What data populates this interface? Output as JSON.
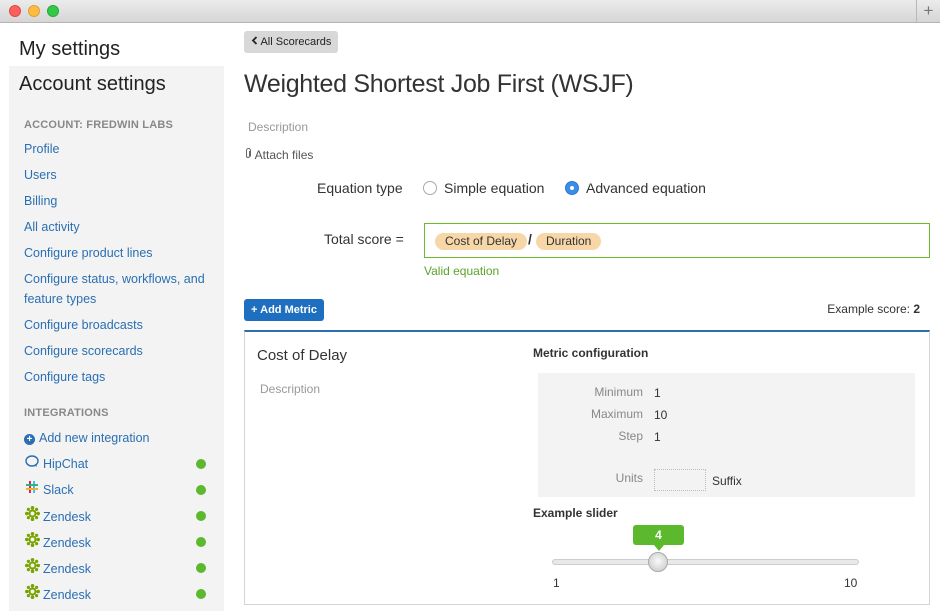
{
  "window": {
    "controls": [
      "close",
      "minimize",
      "zoom"
    ],
    "new_tab_symbol": "+"
  },
  "sidebar": {
    "my_settings": "My settings",
    "account_settings": "Account settings",
    "account_section": "ACCOUNT: FREDWIN LABS",
    "links": {
      "profile": "Profile",
      "users": "Users",
      "billing": "Billing",
      "all_activity": "All activity",
      "product_lines": "Configure product lines",
      "status_line1": "Configure status, workflows, and",
      "status_line2": "feature types",
      "broadcasts": "Configure broadcasts",
      "scorecards": "Configure scorecards",
      "tags": "Configure tags"
    },
    "integrations_section": "INTEGRATIONS",
    "add_integration": "Add new integration",
    "integrations": [
      {
        "label": "HipChat",
        "icon": "hipchat-icon",
        "status": "active"
      },
      {
        "label": "Slack",
        "icon": "slack-icon",
        "status": "active"
      },
      {
        "label": "Zendesk",
        "icon": "zendesk-icon",
        "status": "active"
      },
      {
        "label": "Zendesk",
        "icon": "zendesk-icon",
        "status": "active"
      },
      {
        "label": "Zendesk",
        "icon": "zendesk-icon",
        "status": "active"
      },
      {
        "label": "Zendesk",
        "icon": "zendesk-icon",
        "status": "active"
      }
    ],
    "status_color": "#5cb82c"
  },
  "main": {
    "back_label": "All Scorecards",
    "title": "Weighted Shortest Job First (WSJF)",
    "description_placeholder": "Description",
    "attach_label": "Attach files",
    "equation_type_label": "Equation type",
    "simple_label": "Simple equation",
    "advanced_label": "Advanced equation",
    "selected_equation": "Advanced equation",
    "total_score_label": "Total score =",
    "formula": {
      "term1": "Cost of Delay",
      "operator": "/",
      "term2": "Duration"
    },
    "valid_message": "Valid equation",
    "add_metric_label": "Add Metric",
    "example_score_label": "Example score:",
    "example_score_value": "2"
  },
  "metric": {
    "name": "Cost of Delay",
    "description_placeholder": "Description",
    "config_title": "Metric configuration",
    "minimum_label": "Minimum",
    "minimum_value": "1",
    "maximum_label": "Maximum",
    "maximum_value": "10",
    "step_label": "Step",
    "step_value": "1",
    "units_label": "Units",
    "units_value": "",
    "suffix_label": "Suffix",
    "slider_title": "Example slider",
    "slider_value": "4",
    "slider_min": "1",
    "slider_max": "10"
  },
  "colors": {
    "accent": "#1f6fc0",
    "link": "#2a6fb3",
    "valid": "#5ba42a",
    "pill": "#f7d7a8"
  }
}
